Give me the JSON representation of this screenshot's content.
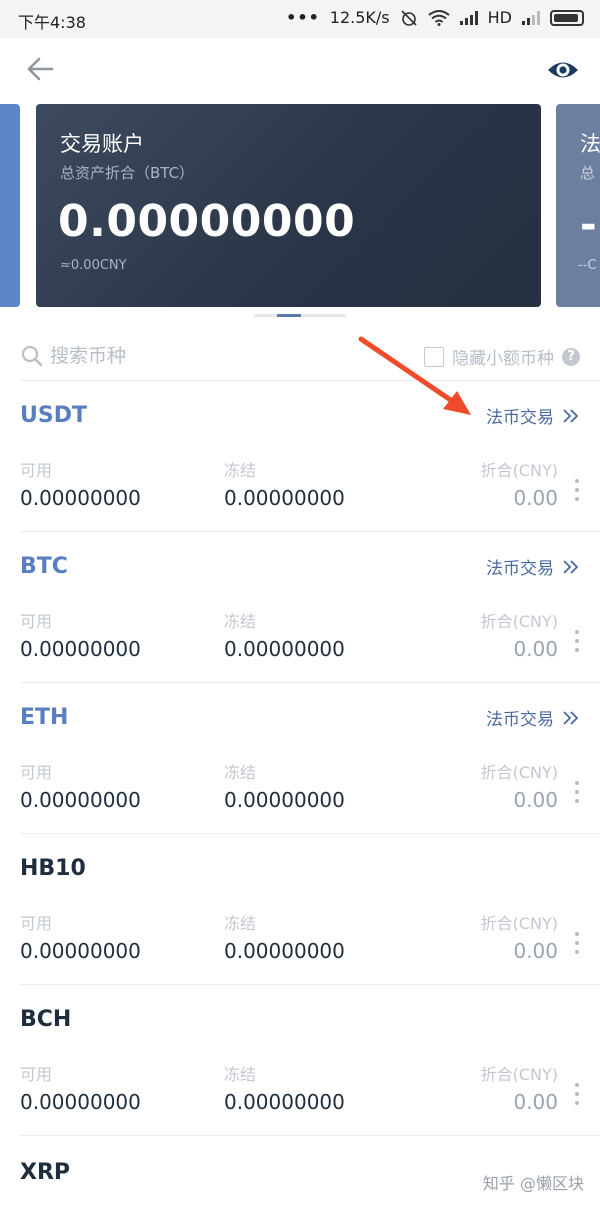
{
  "status_bar": {
    "time": "下午4:38",
    "speed": "12.5K/s",
    "network": "HD"
  },
  "header": {
    "back_icon": "arrow-left-icon",
    "eye_icon": "eye-icon",
    "accent_color": "#1d3a5f"
  },
  "cards": {
    "main": {
      "title": "交易账户",
      "subtitle": "总资产折合（BTC）",
      "amount": "0.00000000",
      "cny": "≈0.00CNY"
    },
    "next": {
      "title": "法",
      "subtitle": "总",
      "amount": "-",
      "cny": "--C"
    }
  },
  "search": {
    "placeholder": "搜索币种",
    "hide_small_label": "隐藏小额币种",
    "help_glyph": "?"
  },
  "columns": {
    "available": "可用",
    "frozen": "冻结",
    "cny": "折合(CNY)"
  },
  "assets": [
    {
      "symbol": "USDT",
      "trade_label": "法币交易",
      "available": "0.00000000",
      "frozen": "0.00000000",
      "cny": "0.00"
    },
    {
      "symbol": "BTC",
      "trade_label": "法币交易",
      "available": "0.00000000",
      "frozen": "0.00000000",
      "cny": "0.00"
    },
    {
      "symbol": "ETH",
      "trade_label": "法币交易",
      "available": "0.00000000",
      "frozen": "0.00000000",
      "cny": "0.00"
    },
    {
      "symbol": "HB10",
      "available": "0.00000000",
      "frozen": "0.00000000",
      "cny": "0.00"
    },
    {
      "symbol": "BCH",
      "available": "0.00000000",
      "frozen": "0.00000000",
      "cny": "0.00"
    }
  ],
  "partial_symbol": "XRP",
  "watermark": "知乎 @懒区块",
  "colors": {
    "highlight_symbol": "#5a7fbf",
    "trade_link": "#4a6aa6",
    "card_bg": "#2a3447",
    "annotation_arrow": "#f04b2b"
  }
}
